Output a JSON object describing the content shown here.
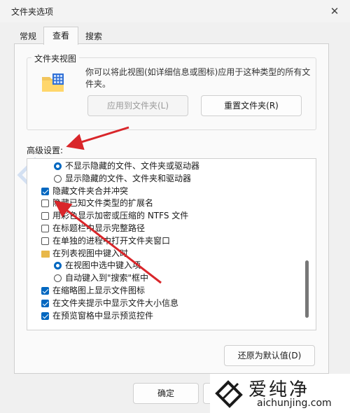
{
  "window": {
    "title": "文件夹选项",
    "close_glyph": "✕"
  },
  "tabs": [
    {
      "label": "常规"
    },
    {
      "label": "查看"
    },
    {
      "label": "搜索"
    }
  ],
  "folder_views": {
    "group_title": "文件夹视图",
    "description": "你可以将此视图(如详细信息或图标)应用于这种类型的所有文件夹。",
    "apply_button": "应用到文件夹(L)",
    "reset_button": "重置文件夹(R)"
  },
  "advanced": {
    "label": "高级设置:",
    "items": [
      {
        "kind": "radio",
        "checked": true,
        "indent": 2,
        "label": "不显示隐藏的文件、文件夹或驱动器"
      },
      {
        "kind": "radio",
        "checked": false,
        "indent": 2,
        "label": "显示隐藏的文件、文件夹和驱动器"
      },
      {
        "kind": "checkbox",
        "checked": true,
        "indent": 1,
        "label": "隐藏文件夹合并冲突"
      },
      {
        "kind": "checkbox",
        "checked": false,
        "indent": 1,
        "label": "隐藏已知文件类型的扩展名"
      },
      {
        "kind": "checkbox",
        "checked": false,
        "indent": 1,
        "label": "用彩色显示加密或压缩的 NTFS 文件"
      },
      {
        "kind": "checkbox",
        "checked": false,
        "indent": 1,
        "label": "在标题栏中显示完整路径"
      },
      {
        "kind": "checkbox",
        "checked": false,
        "indent": 1,
        "label": "在单独的进程中打开文件夹窗口"
      },
      {
        "kind": "folder",
        "checked": false,
        "indent": 1,
        "label": "在列表视图中键入时"
      },
      {
        "kind": "radio",
        "checked": true,
        "indent": 2,
        "label": "在视图中选中键入项"
      },
      {
        "kind": "radio",
        "checked": false,
        "indent": 2,
        "label": "自动键入到\"搜索\"框中"
      },
      {
        "kind": "checkbox",
        "checked": true,
        "indent": 1,
        "label": "在缩略图上显示文件图标"
      },
      {
        "kind": "checkbox",
        "checked": true,
        "indent": 1,
        "label": "在文件夹提示中显示文件大小信息"
      },
      {
        "kind": "checkbox",
        "checked": true,
        "indent": 1,
        "label": "在预览窗格中显示预览控件"
      }
    ],
    "restore_button": "还原为默认值(D)"
  },
  "footer": {
    "ok_button": "确定"
  },
  "watermark": {
    "brand": "爱纯净",
    "url": "aichunjing.com"
  },
  "colors": {
    "accent": "#0067c0",
    "annotation": "#d9262a",
    "folder": "#e8b84a"
  }
}
